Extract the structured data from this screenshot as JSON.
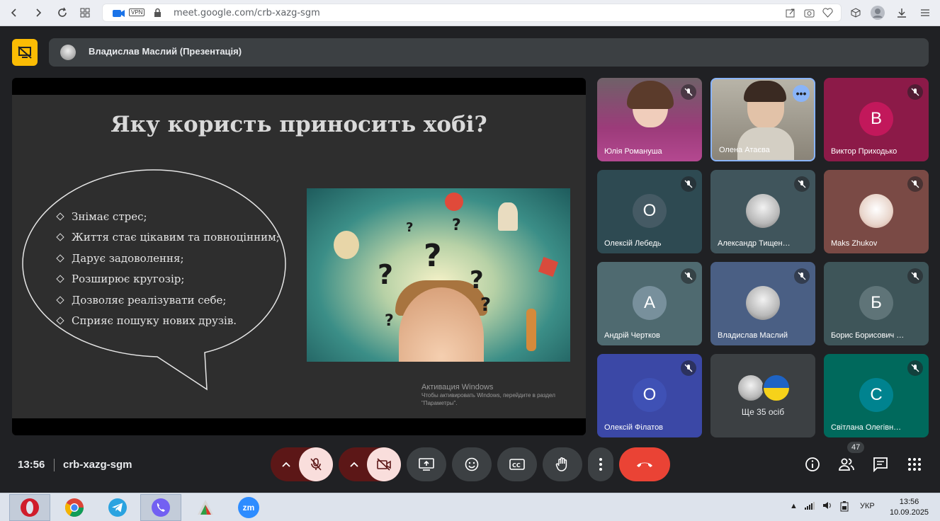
{
  "browser": {
    "vpn_label": "VPN",
    "url": "meet.google.com/crb-xazg-sgm"
  },
  "presenter": {
    "name": "Владислав Маслий (Презентація)"
  },
  "slide": {
    "title": "Яку користь приносить хобі?",
    "bullets": [
      "Знімає стрес;",
      "Життя стає цікавим та повноцінним;",
      "Дарує задоволення;",
      "Розширює кругозір;",
      "Дозволяє реалізувати себе;",
      "Сприяє пошуку нових друзів."
    ],
    "windows_activation_title": "Активация Windows",
    "windows_activation_text": "Чтобы активировать Windows, перейдите в раздел \"Параметры\"."
  },
  "participants": [
    {
      "name": "Юлія Романуша",
      "initial": "",
      "color": "#7a4a6a"
    },
    {
      "name": "Олена Атаєва",
      "initial": "",
      "color": "#8d8f8f"
    },
    {
      "name": "Виктор Приходько",
      "initial": "В",
      "color": "#c2185b"
    },
    {
      "name": "Олексій Лебедь",
      "initial": "О",
      "color": "#2e4a52"
    },
    {
      "name": "Александр Тищен…",
      "initial": "",
      "color": "#40555c"
    },
    {
      "name": "Maks Zhukov",
      "initial": "",
      "color": "#7a4a45"
    },
    {
      "name": "Андрій Чертков",
      "initial": "А",
      "color": "#4f6a70"
    },
    {
      "name": "Владислав Маслий",
      "initial": "",
      "color": "#4a5f84"
    },
    {
      "name": "Борис Борисович …",
      "initial": "Б",
      "color": "#3e5559"
    },
    {
      "name": "Олексій Філатов",
      "initial": "О",
      "color": "#3b48a6"
    },
    {
      "name": "Світлана Олегівн…",
      "initial": "С",
      "color": "#00796b"
    }
  ],
  "others": {
    "label": "Ще 35 осіб"
  },
  "meeting": {
    "time": "13:56",
    "code": "crb-xazg-sgm",
    "people_count": "47"
  },
  "taskbar": {
    "zoom_label": "zm",
    "language": "УКР",
    "clock_time": "13:56",
    "clock_date": "10.09.2025"
  },
  "colors": {
    "hangup": "#ea4335",
    "muted_bg": "#f9dedc",
    "logo": "#fbbc04"
  }
}
